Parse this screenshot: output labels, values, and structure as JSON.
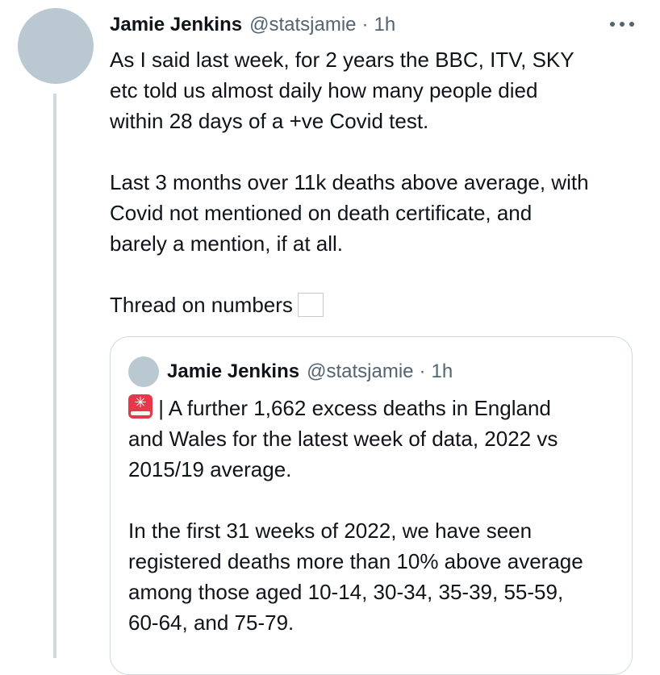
{
  "tweet": {
    "author_name": "Jamie Jenkins",
    "handle": "@statsjamie",
    "separator": "·",
    "time": "1h",
    "more_icon": "more-horizontal-icon",
    "paragraphs": [
      [
        "As I said last week, for 2 years the BBC, ITV, SKY",
        "etc told us almost daily how many people died",
        "within 28 days of a +ve Covid test."
      ],
      [
        "Last 3 months over 11k deaths above average, with",
        "Covid not mentioned on death certificate, and",
        "barely a mention, if at all."
      ]
    ],
    "thread_line": "Thread on numbers",
    "thread_emoji_icon": "unrendered-emoji-box-icon"
  },
  "quoted_tweet": {
    "author_name": "Jamie Jenkins",
    "handle": "@statsjamie",
    "separator": "·",
    "time": "1h",
    "siren_icon": "rotating-light-icon",
    "paragraph1": [
      "| A further 1,662 excess deaths in England",
      "and Wales for the latest week of data, 2022 vs",
      "2015/19 average."
    ],
    "paragraph2": [
      "In the first 31 weeks of 2022, we have seen",
      "registered deaths more than 10% above average",
      "among those aged 10-14, 30-34, 35-39, 55-59,",
      "60-64, and 75-79."
    ]
  },
  "colors": {
    "text": "#0f1419",
    "secondary": "#536471",
    "border": "#cfd9de",
    "avatar_placeholder": "#b9c8d1",
    "siren": "#e8374a"
  }
}
